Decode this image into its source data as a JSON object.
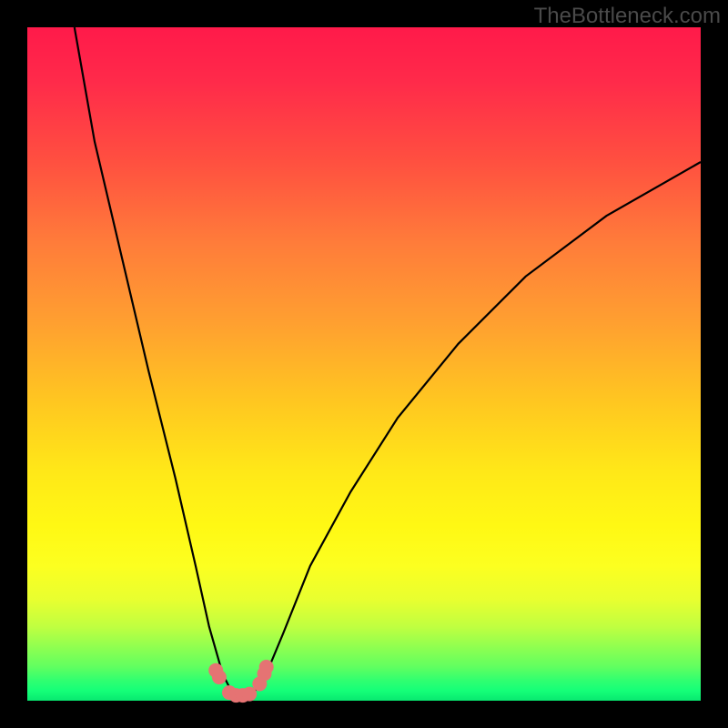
{
  "watermark": "TheBottleneck.com",
  "chart_data": {
    "type": "line",
    "title": "",
    "xlabel": "",
    "ylabel": "",
    "xlim": [
      0,
      100
    ],
    "ylim": [
      0,
      100
    ],
    "background_gradient": {
      "top": "#ff1a4a",
      "middle": "#fff814",
      "bottom": "#15ff78",
      "meaning": "bottleneck severity (red high, green low)"
    },
    "series": [
      {
        "name": "bottleneck-curve",
        "color": "#000000",
        "x": [
          7,
          10,
          14,
          18,
          22,
          25,
          27,
          29,
          30.5,
          32,
          33.5,
          35.5,
          38,
          42,
          48,
          55,
          64,
          74,
          86,
          100
        ],
        "y": [
          100,
          83,
          66,
          49,
          33,
          20,
          11,
          4,
          1,
          0.3,
          1,
          4,
          10,
          20,
          31,
          42,
          53,
          63,
          72,
          80
        ]
      },
      {
        "name": "highlight-minimum",
        "color": "#e57373",
        "type": "scatter",
        "x": [
          28,
          28.5,
          30,
          31,
          32,
          33,
          34.5,
          35.2,
          35.5
        ],
        "y": [
          4.5,
          3.5,
          1.2,
          0.8,
          0.8,
          1.0,
          2.5,
          4.0,
          5.0
        ]
      }
    ],
    "annotations": []
  }
}
